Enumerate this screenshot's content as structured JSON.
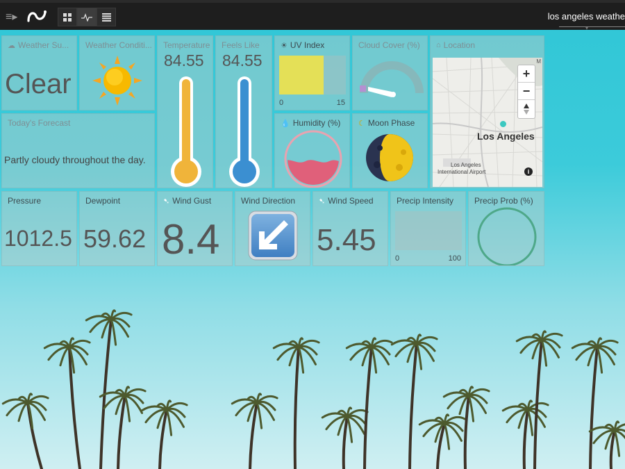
{
  "topbar": {
    "dashboard_title": "los angeles weathe"
  },
  "tiles": {
    "weather_summary": {
      "title": "Weather Su...",
      "value": "Clear"
    },
    "weather_condition": {
      "title": "Weather Conditi...",
      "icon": "sun-icon"
    },
    "temperature": {
      "title": "Temperature",
      "value": "84.55",
      "color": "#f0b43a"
    },
    "feels_like": {
      "title": "Feels Like",
      "value": "84.55",
      "color": "#3b8fd1"
    },
    "uv_index": {
      "title": "UV Index",
      "min": "0",
      "max": "15",
      "level_fraction": 0.55,
      "color": "#e4e057"
    },
    "cloud_cover": {
      "title": "Cloud Cover (%)",
      "value_fraction": 0.0
    },
    "location": {
      "title": "Location",
      "city_label": "Los Angeles",
      "airport_label_line1": "Los Angeles",
      "airport_label_line2": "International Airport",
      "zoom_in": "+",
      "zoom_out": "−",
      "map_corner": "M"
    },
    "todays_forecast": {
      "title": "Today's Forecast",
      "value": "Partly cloudy throughout the day."
    },
    "humidity": {
      "title": "Humidity (%)",
      "level_fraction": 0.4,
      "color": "#e0607a"
    },
    "moon_phase": {
      "title": "Moon Phase",
      "icon": "moon-icon"
    },
    "pressure": {
      "title": "Pressure",
      "value": "1012.5"
    },
    "dewpoint": {
      "title": "Dewpoint",
      "value": "59.62"
    },
    "wind_gust": {
      "title": "Wind Gust",
      "value": "8.4"
    },
    "wind_direction": {
      "title": "Wind Direction",
      "icon": "arrow-down-left-icon"
    },
    "wind_speed": {
      "title": "Wind Speed",
      "value": "5.45"
    },
    "precip_intensity": {
      "title": "Precip Intensity",
      "min": "0",
      "max": "100",
      "level_fraction": 0.0
    },
    "precip_prob": {
      "title": "Precip Prob (%)",
      "level_fraction": 0.0,
      "color": "#4ea889"
    }
  }
}
